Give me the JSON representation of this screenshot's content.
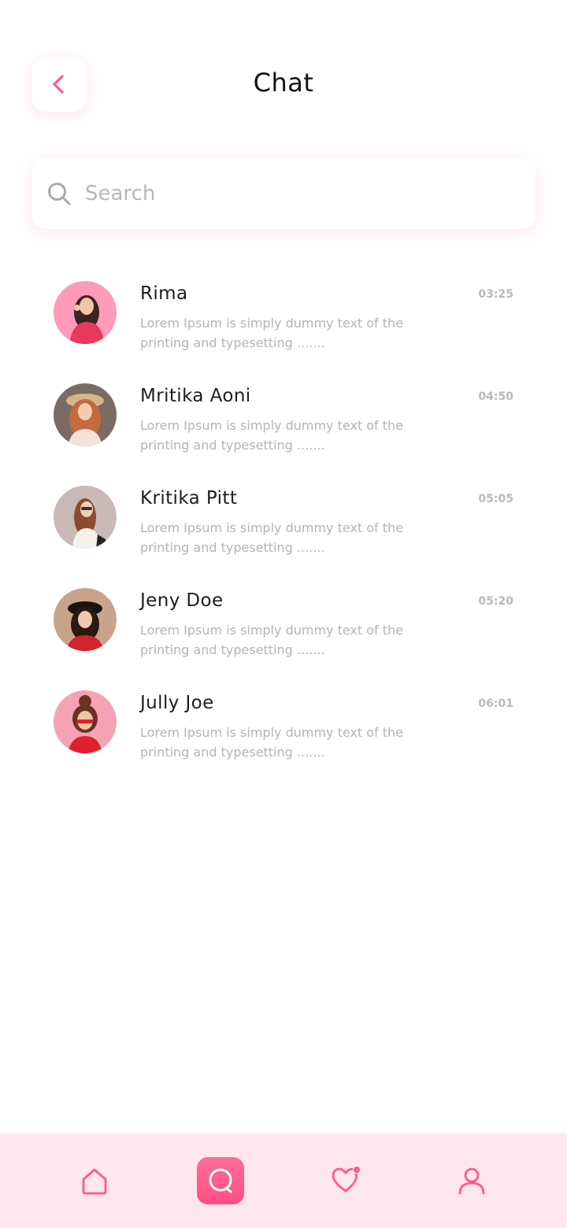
{
  "header": {
    "title": "Chat",
    "back_icon": "chevron-left-icon"
  },
  "search": {
    "placeholder": "Search",
    "icon": "search-icon"
  },
  "chats": [
    {
      "name": "Rima",
      "time": "03:25",
      "message": "Lorem Ipsum is simply dummy text of the printing and typesetting .......",
      "avatar_bg": "#ff9ab8",
      "avatar_hair": "#3a2420",
      "avatar_cloth": "#e8385e"
    },
    {
      "name": "Mritika Aoni",
      "time": "04:50",
      "message": "Lorem Ipsum is simply dummy text of the printing and typesetting .......",
      "avatar_bg": "#7a6b64",
      "avatar_hair": "#c46a3c",
      "avatar_cloth": "#f1e4d6"
    },
    {
      "name": "Kritika Pitt",
      "time": "05:05",
      "message": "Lorem Ipsum is simply dummy text of the printing and typesetting .......",
      "avatar_bg": "#c9b9b8",
      "avatar_hair": "#8a4b30",
      "avatar_cloth": "#f5f2ee"
    },
    {
      "name": "Jeny Doe",
      "time": "05:20",
      "message": "Lorem Ipsum is simply dummy text of the printing and typesetting .......",
      "avatar_bg": "#c9a48a",
      "avatar_hair": "#2a1a14",
      "avatar_cloth": "#d2232e"
    },
    {
      "name": "Jully Joe",
      "time": "06:01",
      "message": "Lorem Ipsum is simply dummy text of the printing and typesetting .......",
      "avatar_bg": "#f5a3b4",
      "avatar_hair": "#6b3222",
      "avatar_cloth": "#e0202c"
    }
  ],
  "nav": {
    "items": [
      {
        "icon": "home-icon",
        "active": false
      },
      {
        "icon": "chat-icon",
        "active": true
      },
      {
        "icon": "heart-icon",
        "active": false
      },
      {
        "icon": "user-icon",
        "active": false
      }
    ]
  },
  "colors": {
    "accent": "#ff5a8c",
    "nav_bg": "#fde6ee",
    "muted_text": "#b3b3ba",
    "title_text": "#111111"
  }
}
